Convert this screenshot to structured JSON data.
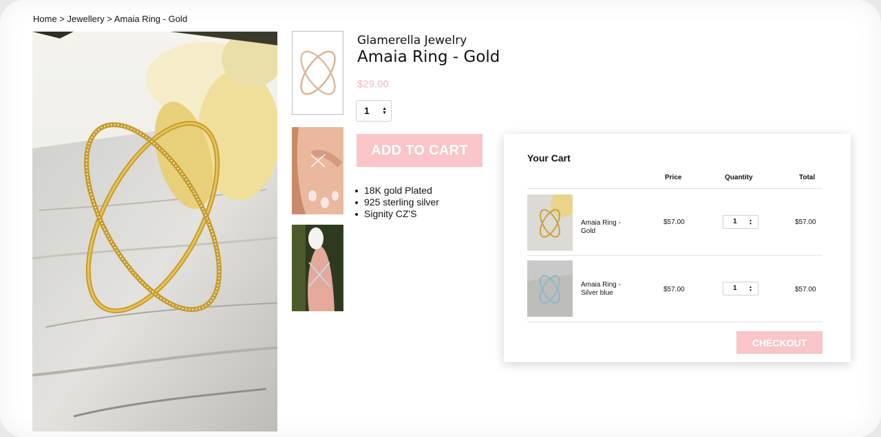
{
  "breadcrumb": {
    "home": "Home",
    "sep": ">",
    "category": "Jewellery",
    "current": "Amaia Ring - Gold"
  },
  "product": {
    "brand": "Glamerella Jewelry",
    "title": "Amaia Ring - Gold",
    "price": "$29.00",
    "quantity": "1",
    "add_to_cart": "ADD TO CART",
    "features": [
      "18K gold Plated",
      "925 sterling silver",
      "Signity CZ'S"
    ]
  },
  "cart": {
    "title": "Your Cart",
    "headers": {
      "price": "Price",
      "quantity": "Quantity",
      "total": "Total"
    },
    "items": [
      {
        "name": "Amaia Ring - Gold",
        "price": "$57.00",
        "quantity": "1",
        "total": "$57.00"
      },
      {
        "name": "Amaia Ring - Silver blue",
        "price": "$57.00",
        "quantity": "1",
        "total": "$57.00"
      }
    ],
    "checkout": "CHECKOUT"
  },
  "colors": {
    "accent_pink": "#f9c5c8",
    "price_pink": "#f5b8bd"
  },
  "icons": [
    "chevron-up-down-icon"
  ]
}
